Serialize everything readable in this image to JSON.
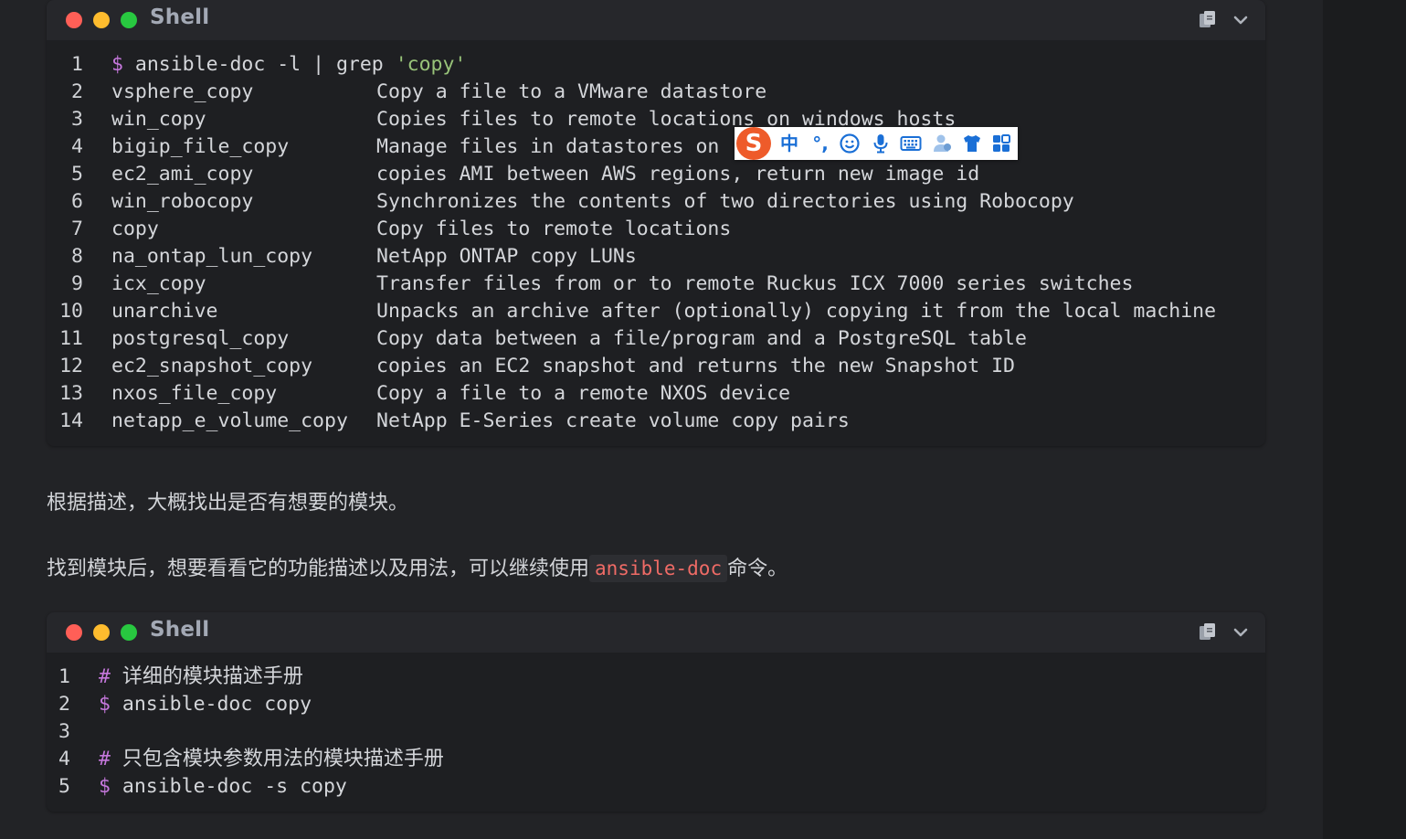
{
  "block1": {
    "language": "Shell",
    "lines": [
      {
        "n": "1",
        "prompt": "$",
        "cmd": "ansible-doc -l | grep ",
        "str": "'copy'"
      },
      {
        "n": "2",
        "name": "vsphere_copy",
        "desc": "Copy a file to a VMware datastore"
      },
      {
        "n": "3",
        "name": "win_copy",
        "desc": "Copies files to remote locations on windows hosts"
      },
      {
        "n": "4",
        "name": "bigip_file_copy",
        "desc": "Manage files in datastores on"
      },
      {
        "n": "5",
        "name": "ec2_ami_copy",
        "desc": "copies AMI between AWS regions, return new image id"
      },
      {
        "n": "6",
        "name": "win_robocopy",
        "desc": "Synchronizes the contents of two directories using Robocopy"
      },
      {
        "n": "7",
        "name": "copy",
        "desc": "Copy files to remote locations"
      },
      {
        "n": "8",
        "name": "na_ontap_lun_copy",
        "desc": "NetApp ONTAP copy LUNs"
      },
      {
        "n": "9",
        "name": "icx_copy",
        "desc": "Transfer files from or to remote Ruckus ICX 7000 series switches"
      },
      {
        "n": "10",
        "name": "unarchive",
        "desc": "Unpacks an archive after (optionally) copying it from the local machine"
      },
      {
        "n": "11",
        "name": "postgresql_copy",
        "desc": "Copy data between a file/program and a PostgreSQL table"
      },
      {
        "n": "12",
        "name": "ec2_snapshot_copy",
        "desc": "copies an EC2 snapshot and returns the new Snapshot ID"
      },
      {
        "n": "13",
        "name": "nxos_file_copy",
        "desc": "Copy a file to a remote NXOS device"
      },
      {
        "n": "14",
        "name": "netapp_e_volume_copy",
        "desc": "NetApp E-Series create volume copy pairs"
      }
    ]
  },
  "para1": "根据描述，大概找出是否有想要的模块。",
  "para2": {
    "before": "找到模块后，想要看看它的功能描述以及用法，可以继续使用",
    "code": "ansible-doc",
    "after": "命令。"
  },
  "block2": {
    "language": "Shell",
    "lines": [
      {
        "n": "1",
        "type": "comment",
        "mark": "#",
        "text": "详细的模块描述手册"
      },
      {
        "n": "2",
        "type": "cmd",
        "mark": "$",
        "text": "ansible-doc copy"
      },
      {
        "n": "3",
        "type": "empty",
        "mark": "",
        "text": ""
      },
      {
        "n": "4",
        "type": "comment",
        "mark": "#",
        "text": "只包含模块参数用法的模块描述手册"
      },
      {
        "n": "5",
        "type": "cmd",
        "mark": "$",
        "text": "ansible-doc -s copy"
      }
    ]
  },
  "ime": {
    "logo": "S",
    "mode": "中",
    "punct": "°,",
    "icons": [
      "emoji-icon",
      "microphone-icon",
      "keyboard-icon",
      "user-voice-icon",
      "skin-shirt-icon",
      "toolbox-grid-icon"
    ],
    "accent": "#1a6fd6",
    "brand": "#ee5b2a"
  }
}
